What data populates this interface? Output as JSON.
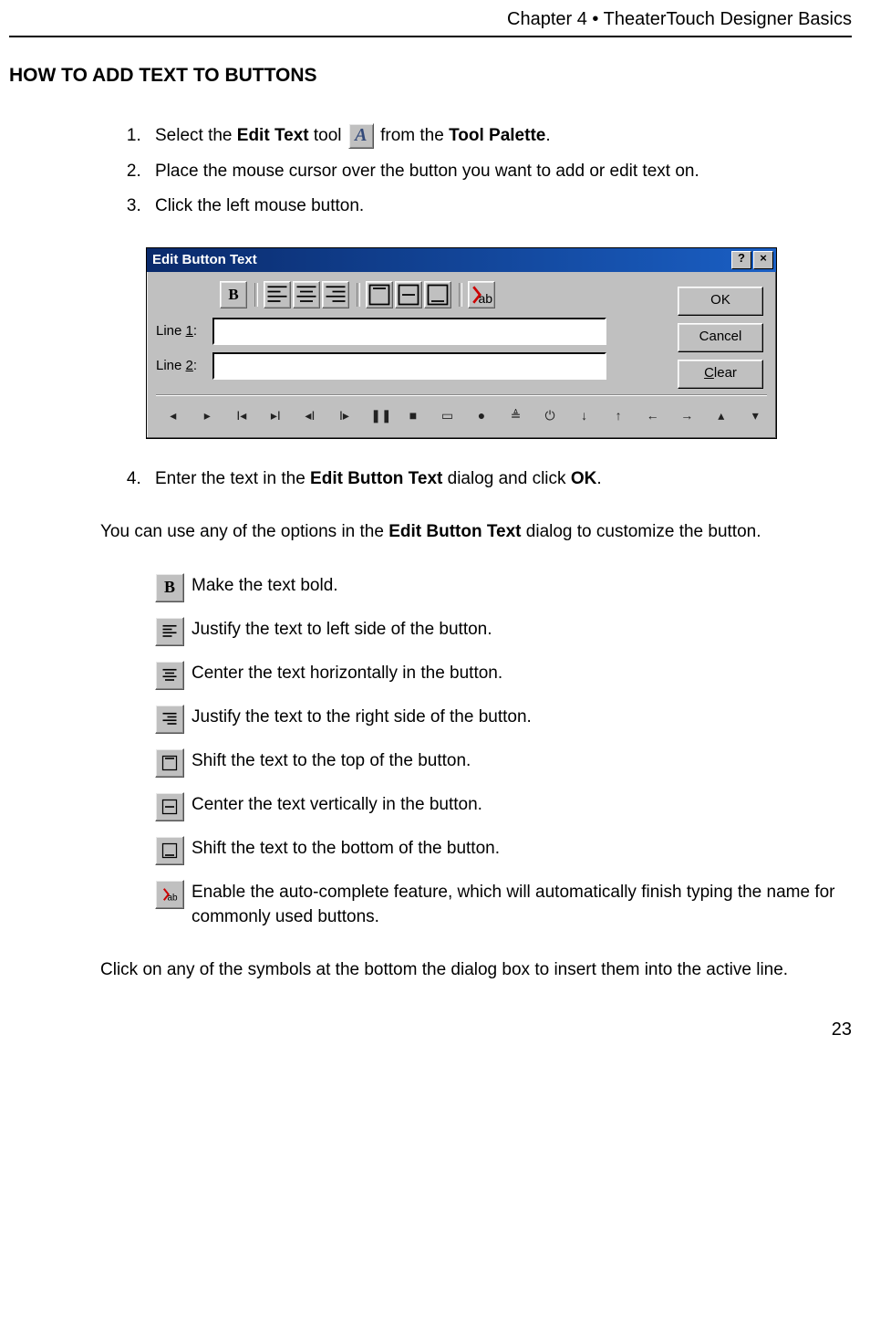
{
  "header": "Chapter 4 • TheaterTouch Designer Basics",
  "section_title": "HOW TO ADD TEXT TO BUTTONS",
  "steps": {
    "s1a": "Select the ",
    "s1b": "Edit Text",
    "s1c": " tool ",
    "s1d": " from the ",
    "s1e": "Tool Palette",
    "s1f": ".",
    "s2": "Place the mouse cursor over the button you want to add or edit text on.",
    "s3": "Click the left mouse button.",
    "s4a": "Enter the text in the ",
    "s4b": "Edit Button Text",
    "s4c": " dialog and click ",
    "s4d": "OK",
    "s4e": "."
  },
  "dialog": {
    "title": "Edit Button Text",
    "line1_label_pre": "Line ",
    "line1_label_u": "1",
    "line1_label_post": ":",
    "line2_label_pre": "Line ",
    "line2_label_u": "2",
    "line2_label_post": ":",
    "btn_ok": "OK",
    "btn_cancel": "Cancel",
    "btn_clear_u": "C",
    "btn_clear_rest": "lear",
    "help_btn": "?",
    "close_btn": "×",
    "line1_value": "",
    "line2_value": ""
  },
  "para1a": "You can use any of the options in the ",
  "para1b": "Edit Button Text",
  "para1c": " dialog to customize the button.",
  "icons": {
    "bold": "Make the text bold.",
    "left": "Justify the text to left side of the button.",
    "center": "Center the text horizontally in the button.",
    "right": "Justify the text to the right side of the button.",
    "top": "Shift the text to the top of the button.",
    "vcenter": "Center the text vertically in the button.",
    "bottom": "Shift the text to the bottom of the button.",
    "auto": "Enable the auto-complete feature, which will automatically finish typing the name for commonly used buttons."
  },
  "closing": "Click on any of the symbols at the bottom the dialog box to insert them into the active line.",
  "pageno": "23",
  "tool_icon_letter": "A"
}
